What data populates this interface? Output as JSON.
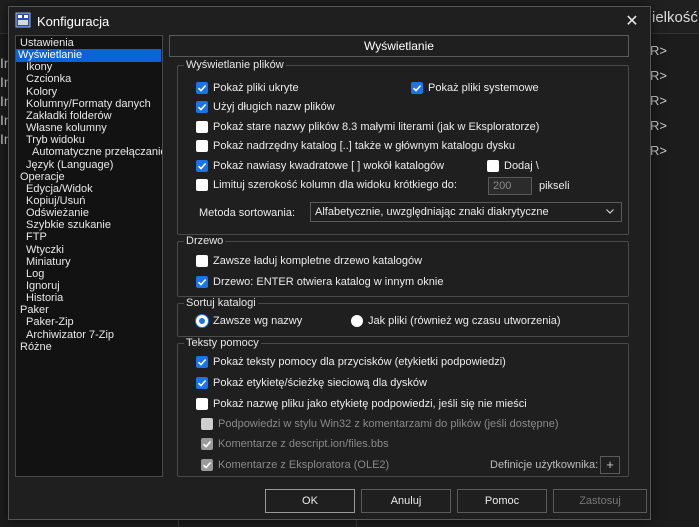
{
  "background": {
    "top_right_text": "ielkość",
    "left_column": [
      "In",
      "In",
      "In",
      "In",
      "In"
    ],
    "right_column": [
      "R>",
      "R>",
      "R>",
      "R>",
      "R>"
    ]
  },
  "window": {
    "title": "Konfiguracja",
    "close_glyph": "✕"
  },
  "tree": [
    {
      "label": "Ustawienia",
      "indent": 0
    },
    {
      "label": "Wyświetlanie",
      "indent": 0,
      "selected": true
    },
    {
      "label": "Ikony",
      "indent": 1
    },
    {
      "label": "Czcionka",
      "indent": 1
    },
    {
      "label": "Kolory",
      "indent": 1
    },
    {
      "label": "Kolumny/Formaty danych",
      "indent": 1
    },
    {
      "label": "Zakładki folderów",
      "indent": 1
    },
    {
      "label": "Własne kolumny",
      "indent": 1
    },
    {
      "label": "Tryb widoku",
      "indent": 1
    },
    {
      "label": "Automatyczne przełączanie",
      "indent": 2
    },
    {
      "label": "Język (Language)",
      "indent": 1
    },
    {
      "label": "Operacje",
      "indent": 0
    },
    {
      "label": "Edycja/Widok",
      "indent": 1
    },
    {
      "label": "Kopiuj/Usuń",
      "indent": 1
    },
    {
      "label": "Odświeżanie",
      "indent": 1
    },
    {
      "label": "Szybkie szukanie",
      "indent": 1
    },
    {
      "label": "FTP",
      "indent": 1
    },
    {
      "label": "Wtyczki",
      "indent": 1
    },
    {
      "label": "Miniatury",
      "indent": 1
    },
    {
      "label": "Log",
      "indent": 1
    },
    {
      "label": "Ignoruj",
      "indent": 1
    },
    {
      "label": "Historia",
      "indent": 1
    },
    {
      "label": "Paker",
      "indent": 0
    },
    {
      "label": "Paker-Zip",
      "indent": 1
    },
    {
      "label": "Archiwizator 7-Zip",
      "indent": 1
    },
    {
      "label": "Różne",
      "indent": 0
    }
  ],
  "panel": {
    "header": "Wyświetlanie",
    "files_group": {
      "title": "Wyświetlanie plików",
      "show_hidden": {
        "label": "Pokaż pliki ukryte",
        "checked": true
      },
      "show_system": {
        "label": "Pokaż pliki systemowe",
        "checked": true
      },
      "long_names": {
        "label": "Użyj długich nazw plików",
        "checked": true
      },
      "old_83": {
        "label": "Pokaż stare nazwy plików 8.3 małymi literami (jak w Eksploratorze)",
        "checked": false
      },
      "parent_dir": {
        "label": "Pokaż nadrzędny katalog [..] także w głównym katalogu dysku",
        "checked": false
      },
      "brackets": {
        "label": "Pokaż nawiasy kwadratowe [ ] wokół katalogów",
        "checked": true
      },
      "add_backslash": {
        "label": "Dodaj \\",
        "checked": false
      },
      "limit_width": {
        "label": "Limituj szerokość kolumn dla widoku krótkiego do:",
        "checked": false
      },
      "limit_value": "200",
      "limit_unit": "pikseli",
      "sort_label": "Metoda sortowania:",
      "sort_value": "Alfabetycznie, uwzględniając znaki diakrytyczne"
    },
    "tree_group": {
      "title": "Drzewo",
      "always_load": {
        "label": "Zawsze ładuj kompletne drzewo katalogów",
        "checked": false
      },
      "enter_opens": {
        "label": "Drzewo: ENTER otwiera katalog w innym oknie",
        "checked": true
      }
    },
    "sort_group": {
      "title": "Sortuj katalogi",
      "by_name": {
        "label": "Zawsze wg nazwy",
        "selected": true
      },
      "like_files": {
        "label": "Jak pliki (również wg czasu utworzenia)",
        "selected": false
      }
    },
    "tooltips_group": {
      "title": "Teksty pomocy",
      "button_tips": {
        "label": "Pokaż teksty pomocy dla przycisków (etykietki podpowiedzi)",
        "checked": true
      },
      "drive_label": {
        "label": "Pokaż etykietę/ścieżkę sieciową dla dysków",
        "checked": true
      },
      "filename_tip": {
        "label": "Pokaż nazwę pliku jako etykietę podpowiedzi, jeśli się nie mieści",
        "checked": false
      },
      "win32_style": {
        "label": "Podpowiedzi w stylu Win32 z komentarzami do plików (jeśli dostępne)",
        "checked": false
      },
      "descript": {
        "label": "Komentarze z descript.ion/files.bbs",
        "checked": true
      },
      "explorer": {
        "label": "Komentarze z Eksploratora (OLE2)",
        "checked": true
      },
      "user_defs_label": "Definicje użytkownika:",
      "plus": "+"
    }
  },
  "buttons": {
    "ok": "OK",
    "cancel": "Anuluj",
    "help": "Pomoc",
    "apply": "Zastosuj"
  },
  "colors": {
    "accent": "#1a73e8",
    "selection": "#0a64d8",
    "background": "#1f1f1f"
  }
}
